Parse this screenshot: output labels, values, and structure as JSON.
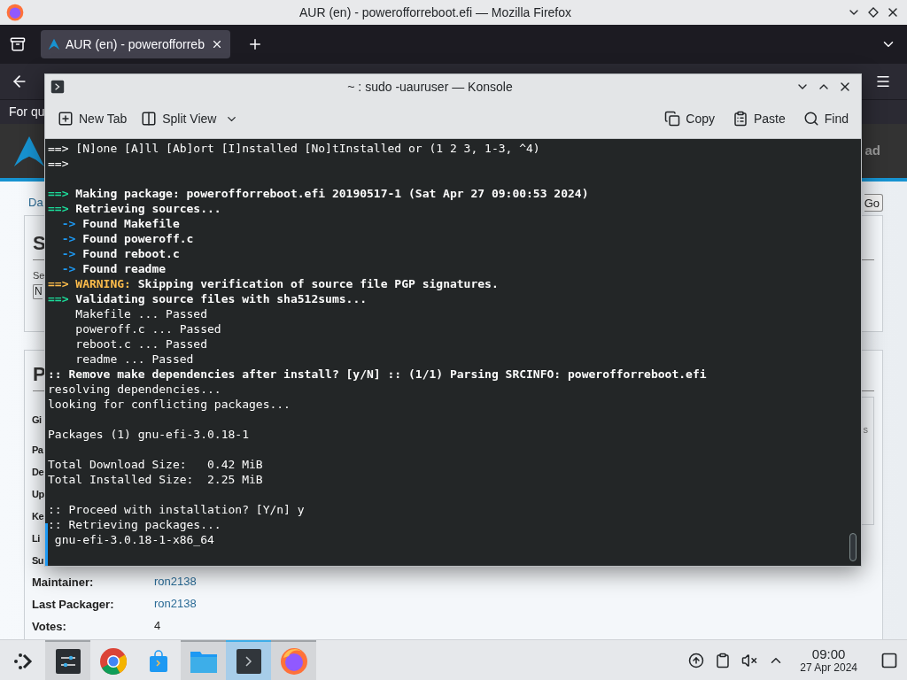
{
  "browser": {
    "title": "AUR (en) - powerofforreboot.efi — Mozilla Firefox",
    "tabs": [
      {
        "label": "AUR (en) - powerofforreb",
        "selected": true
      }
    ],
    "notice": "For qu"
  },
  "aur_page": {
    "header_link": "ad",
    "breadcrumb": "Da",
    "go_button": "Go",
    "search_box": {
      "heading": "S",
      "field_label": "Se",
      "select_value": "N"
    },
    "details_box": {
      "heading": "P",
      "side_text": "s",
      "rows": [
        {
          "label": "Gi"
        },
        {
          "label": "Pa"
        },
        {
          "label": "De"
        },
        {
          "label": "Up"
        },
        {
          "label": "Ke"
        },
        {
          "label": "Li"
        },
        {
          "label": "Su"
        },
        {
          "label": "Maintainer:",
          "value": "ron2138",
          "link": true
        },
        {
          "label": "Last Packager:",
          "value": "ron2138",
          "link": true
        },
        {
          "label": "Votes:",
          "value": "4",
          "link": false
        }
      ]
    }
  },
  "konsole": {
    "title": "~ : sudo -uauruser — Konsole",
    "toolbar_left": [
      {
        "kind": "new_tab",
        "label": "New Tab"
      },
      {
        "kind": "split_view",
        "label": "Split View"
      }
    ],
    "toolbar_right": [
      {
        "kind": "copy",
        "label": "Copy"
      },
      {
        "kind": "paste",
        "label": "Paste"
      },
      {
        "kind": "find",
        "label": "Find"
      }
    ],
    "lines": [
      {
        "segments": [
          {
            "kind": "plain",
            "text": "==> [N]one [A]ll [Ab]ort [I]nstalled [No]tInstalled or (1 2 3, 1-3, ^4)"
          }
        ]
      },
      {
        "segments": [
          {
            "kind": "plain",
            "text": "==>"
          }
        ]
      },
      {
        "kind": "blank"
      },
      {
        "segments": [
          {
            "kind": "prompt",
            "text": "==>"
          },
          {
            "kind": "bold",
            "text": " Making package: powerofforreboot.efi 20190517-1 (Sat Apr 27 09:00:53 2024)"
          }
        ]
      },
      {
        "segments": [
          {
            "kind": "prompt",
            "text": "==>"
          },
          {
            "kind": "bold",
            "text": " Retrieving sources..."
          }
        ]
      },
      {
        "segments": [
          {
            "kind": "arrow",
            "text": "  ->"
          },
          {
            "kind": "bold",
            "text": " Found Makefile"
          }
        ]
      },
      {
        "segments": [
          {
            "kind": "arrow",
            "text": "  ->"
          },
          {
            "kind": "bold",
            "text": " Found poweroff.c"
          }
        ]
      },
      {
        "segments": [
          {
            "kind": "arrow",
            "text": "  ->"
          },
          {
            "kind": "bold",
            "text": " Found reboot.c"
          }
        ]
      },
      {
        "segments": [
          {
            "kind": "arrow",
            "text": "  ->"
          },
          {
            "kind": "bold",
            "text": " Found readme"
          }
        ]
      },
      {
        "segments": [
          {
            "kind": "warn_prompt",
            "text": "==>"
          },
          {
            "kind": "warning",
            "text": " WARNING:"
          },
          {
            "kind": "bold",
            "text": " Skipping verification of source file PGP signatures."
          }
        ]
      },
      {
        "segments": [
          {
            "kind": "prompt",
            "text": "==>"
          },
          {
            "kind": "bold",
            "text": " Validating source files with sha512sums..."
          }
        ]
      },
      {
        "segments": [
          {
            "kind": "plain",
            "text": "    Makefile ... Passed"
          }
        ]
      },
      {
        "segments": [
          {
            "kind": "plain",
            "text": "    poweroff.c ... Passed"
          }
        ]
      },
      {
        "segments": [
          {
            "kind": "plain",
            "text": "    reboot.c ... Passed"
          }
        ]
      },
      {
        "segments": [
          {
            "kind": "plain",
            "text": "    readme ... Passed"
          }
        ]
      },
      {
        "segments": [
          {
            "kind": "bold",
            "text": ":: Remove make dependencies after install? [y/N] :: (1/1) Parsing SRCINFO: powerofforreboot.efi"
          }
        ]
      },
      {
        "segments": [
          {
            "kind": "plain",
            "text": "resolving dependencies..."
          }
        ]
      },
      {
        "segments": [
          {
            "kind": "plain",
            "text": "looking for conflicting packages..."
          }
        ]
      },
      {
        "kind": "blank"
      },
      {
        "segments": [
          {
            "kind": "plain",
            "text": "Packages (1) gnu-efi-3.0.18-1"
          }
        ]
      },
      {
        "kind": "blank"
      },
      {
        "segments": [
          {
            "kind": "plain",
            "text": "Total Download Size:   0.42 MiB"
          }
        ]
      },
      {
        "segments": [
          {
            "kind": "plain",
            "text": "Total Installed Size:  2.25 MiB"
          }
        ]
      },
      {
        "kind": "blank"
      },
      {
        "segments": [
          {
            "kind": "plain",
            "text": ":: Proceed with installation? [Y/n] y"
          }
        ]
      },
      {
        "segments": [
          {
            "kind": "plain",
            "text": ":: Retrieving packages..."
          }
        ]
      },
      {
        "segments": [
          {
            "kind": "plain",
            "text": " gnu-efi-3.0.18-1-x86_64"
          }
        ]
      }
    ]
  },
  "taskbar": {
    "items": [
      {
        "kind": "launcher",
        "open": false,
        "selected": false
      },
      {
        "kind": "settings",
        "open": true,
        "selected": false
      },
      {
        "kind": "chrome",
        "open": false,
        "selected": false
      },
      {
        "kind": "store",
        "open": false,
        "selected": false
      },
      {
        "kind": "files",
        "open": true,
        "selected": false
      },
      {
        "kind": "terminal",
        "open": true,
        "selected": true
      },
      {
        "kind": "firefox",
        "open": true,
        "selected": false
      }
    ],
    "time": "09:00",
    "date": "27 Apr 2024"
  }
}
